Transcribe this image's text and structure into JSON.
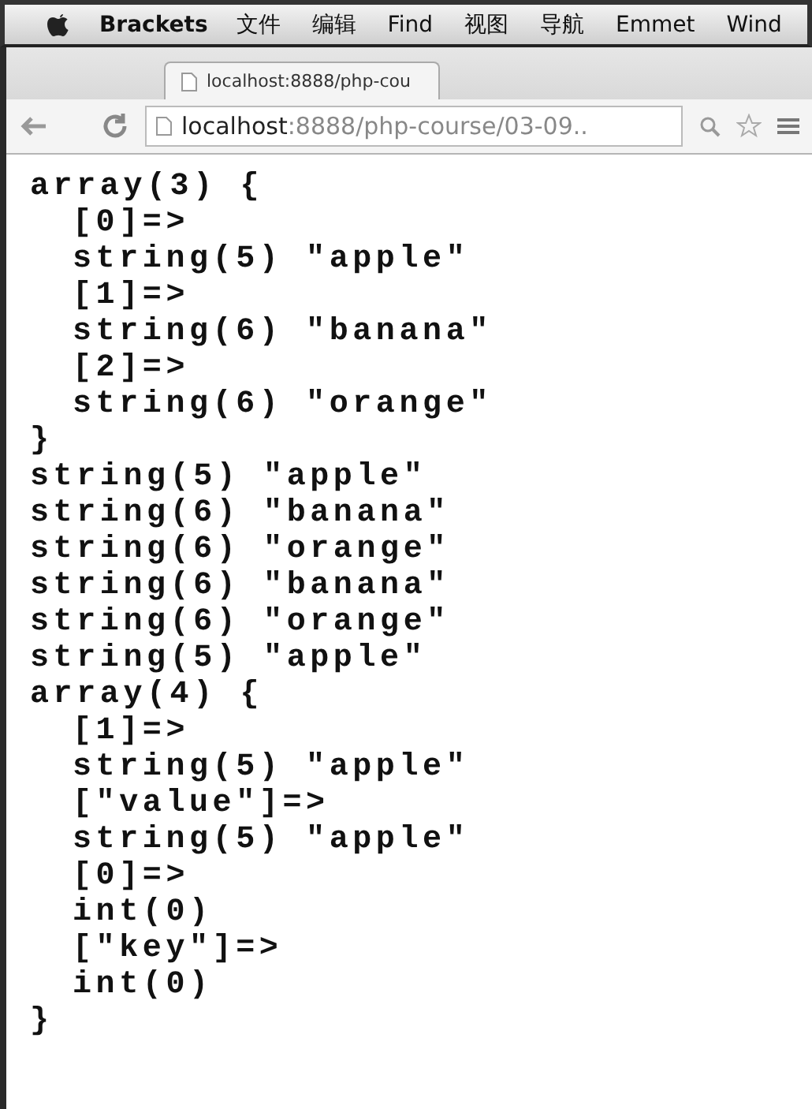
{
  "menu_bar": {
    "items": [
      "Brackets",
      "文件",
      "编辑",
      "Find",
      "视图",
      "导航",
      "Emmet",
      "Wind"
    ]
  },
  "browser": {
    "tab": {
      "title": "localhost:8888/php-cou"
    },
    "address": {
      "host": "localhost",
      "path": ":8888/php-course/03-09.."
    }
  },
  "output": [
    {
      "text": "array(3) {",
      "kind": "plain"
    },
    {
      "text": "[0]=>",
      "kind": "indented"
    },
    {
      "text": "string(5) \"apple\"",
      "kind": "indented"
    },
    {
      "text": "[1]=>",
      "kind": "indented"
    },
    {
      "text": "string(6) \"banana\"",
      "kind": "indented"
    },
    {
      "text": "[2]=>",
      "kind": "indented"
    },
    {
      "text": "string(6) \"orange\"",
      "kind": "indented"
    },
    {
      "text": "}",
      "kind": "plain"
    },
    {
      "text": "string(5) \"apple\"",
      "kind": "plain"
    },
    {
      "text": "string(6) \"banana\"",
      "kind": "plain"
    },
    {
      "text": "string(6) \"orange\"",
      "kind": "plain"
    },
    {
      "text": "string(6) \"banana\"",
      "kind": "plain"
    },
    {
      "text": "string(6) \"orange\"",
      "kind": "plain"
    },
    {
      "text": "string(5) \"apple\"",
      "kind": "plain"
    },
    {
      "text": "array(4) {",
      "kind": "plain"
    },
    {
      "text": "[1]=>",
      "kind": "indented"
    },
    {
      "text": "string(5) \"apple\"",
      "kind": "indented"
    },
    {
      "text": "[\"value\"]=>",
      "kind": "indented"
    },
    {
      "text": "string(5) \"apple\"",
      "kind": "indented"
    },
    {
      "text": "[0]=>",
      "kind": "indented"
    },
    {
      "text": "int(0)",
      "kind": "indented"
    },
    {
      "text": "[\"key\"]=>",
      "kind": "indented"
    },
    {
      "text": "int(0)",
      "kind": "indented"
    },
    {
      "text": "}",
      "kind": "plain"
    }
  ]
}
